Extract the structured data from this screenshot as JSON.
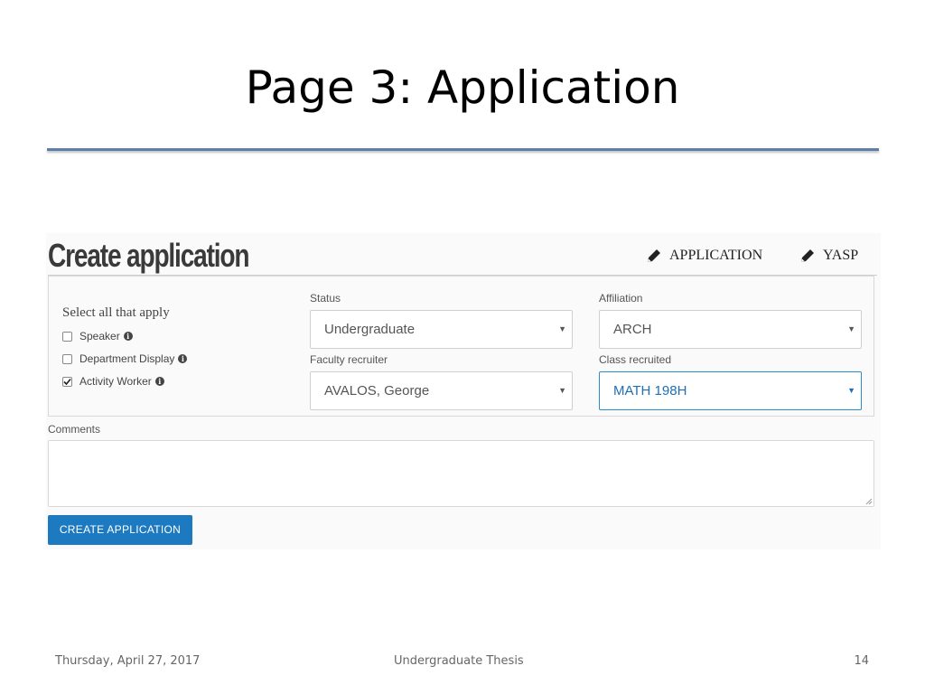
{
  "slide": {
    "title": "Page 3: Application",
    "footer": {
      "date": "Thursday, April 27, 2017",
      "center": "Undergraduate Thesis",
      "page_number": "14"
    }
  },
  "app": {
    "heading": "Create application",
    "nav": {
      "application_label": "APPLICATION",
      "yasp_label": "YASP",
      "icon": "pencil-icon"
    },
    "checkboxes": {
      "heading": "Select all that apply",
      "items": [
        {
          "label": "Speaker",
          "checked": false
        },
        {
          "label": "Department Display",
          "checked": false
        },
        {
          "label": "Activity Worker",
          "checked": true
        }
      ]
    },
    "fields": {
      "status": {
        "label": "Status",
        "value": "Undergraduate"
      },
      "affiliation": {
        "label": "Affiliation",
        "value": "ARCH"
      },
      "faculty_recruiter": {
        "label": "Faculty recruiter",
        "value": "AVALOS, George"
      },
      "class_recruited": {
        "label": "Class recruited",
        "value": "MATH 198H"
      }
    },
    "comments": {
      "label": "Comments",
      "value": ""
    },
    "submit_label": "CREATE APPLICATION",
    "colors": {
      "primary": "#1e7ac0",
      "focus": "#2a8ccf",
      "title_rule": "#5b7fa6"
    }
  }
}
